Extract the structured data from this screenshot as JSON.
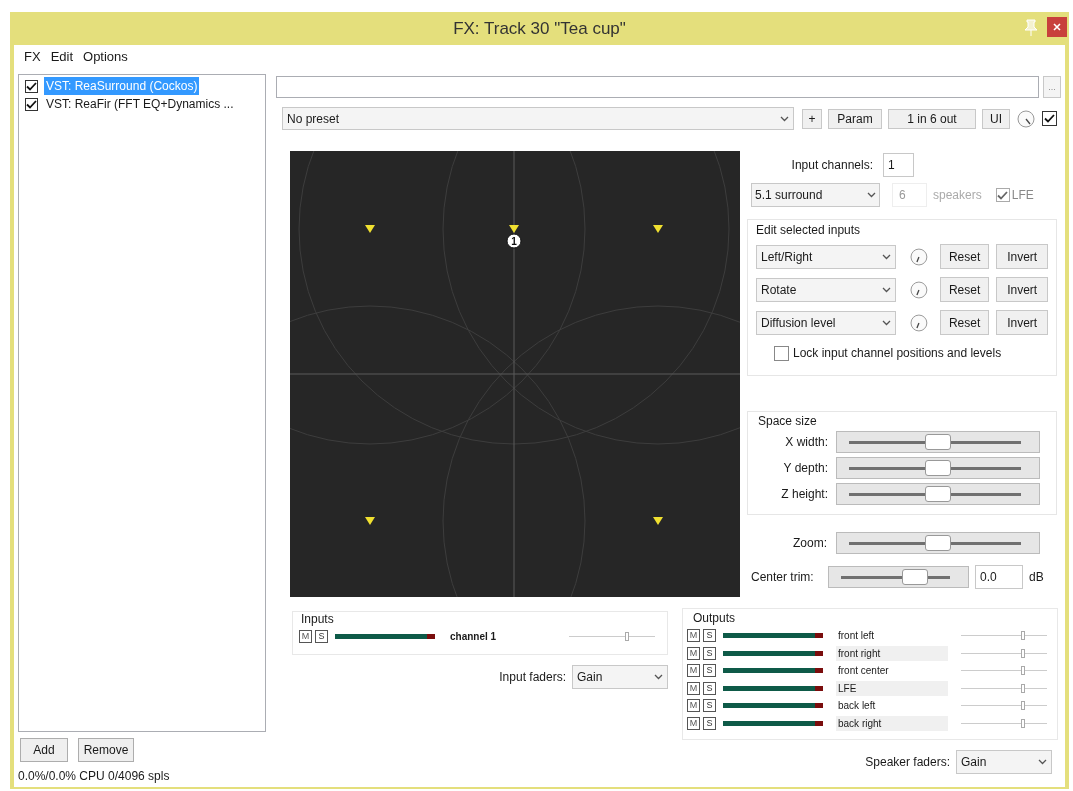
{
  "window": {
    "title": "FX: Track 30 \"Tea cup\""
  },
  "menu": [
    {
      "label": "FX"
    },
    {
      "label": "Edit"
    },
    {
      "label": "Options"
    }
  ],
  "fx_chain": [
    {
      "label": "VST: ReaSurround (Cockos)",
      "checked": true,
      "selected": true
    },
    {
      "label": "VST: ReaFir (FFT EQ+Dynamics ...",
      "checked": true,
      "selected": false
    }
  ],
  "chain_buttons": [
    "Add",
    "Remove"
  ],
  "cpu_status": "0.0%/0.0% CPU 0/4096 spls",
  "browse_button": "...",
  "preset": {
    "value": "No preset"
  },
  "toolbar": {
    "add": "+",
    "param": "Param",
    "io": "1 in 6 out",
    "ui": "UI",
    "enabled": true
  },
  "surround": {
    "input_marker": "1"
  },
  "input_channels": {
    "label": "Input channels:",
    "value": "1"
  },
  "speaker_layout": {
    "value": "5.1 surround",
    "count": "6",
    "count_disabled": true,
    "unit": "speakers",
    "lfe": {
      "label": "LFE",
      "checked": true
    }
  },
  "edit_inputs": {
    "title": "Edit selected inputs",
    "rows": [
      {
        "mode": "Left/Right",
        "reset": "Reset",
        "invert": "Invert"
      },
      {
        "mode": "Rotate",
        "reset": "Reset",
        "invert": "Invert"
      },
      {
        "mode": "Diffusion level",
        "reset": "Reset",
        "invert": "Invert"
      }
    ],
    "lock": {
      "label": "Lock input channel positions and levels",
      "checked": false
    }
  },
  "space_size": {
    "title": "Space size",
    "sliders": [
      {
        "label": "X width:",
        "level": 0.5
      },
      {
        "label": "Y depth:",
        "level": 0.5
      },
      {
        "label": "Z height:",
        "level": 0.5
      }
    ]
  },
  "zoom": {
    "label": "Zoom:",
    "level": 0.5
  },
  "center_trim": {
    "label": "Center trim:",
    "level": 0.62,
    "value": "0.0",
    "unit": "dB"
  },
  "inputs": {
    "title": "Inputs",
    "channels": [
      {
        "mute": "M",
        "solo": "S",
        "name": "channel 1",
        "level": 0.68
      }
    ]
  },
  "input_faders": {
    "label": "Input faders:",
    "value": "Gain"
  },
  "outputs": {
    "title": "Outputs",
    "channels": [
      {
        "mute": "M",
        "solo": "S",
        "name": "front left",
        "level": 0.72
      },
      {
        "mute": "M",
        "solo": "S",
        "name": "front right",
        "level": 0.72
      },
      {
        "mute": "M",
        "solo": "S",
        "name": "front center",
        "level": 0.72
      },
      {
        "mute": "M",
        "solo": "S",
        "name": "LFE",
        "level": 0.72
      },
      {
        "mute": "M",
        "solo": "S",
        "name": "back left",
        "level": 0.72
      },
      {
        "mute": "M",
        "solo": "S",
        "name": "back right",
        "level": 0.72
      }
    ]
  },
  "speaker_faders": {
    "label": "Speaker faders:",
    "value": "Gain"
  }
}
